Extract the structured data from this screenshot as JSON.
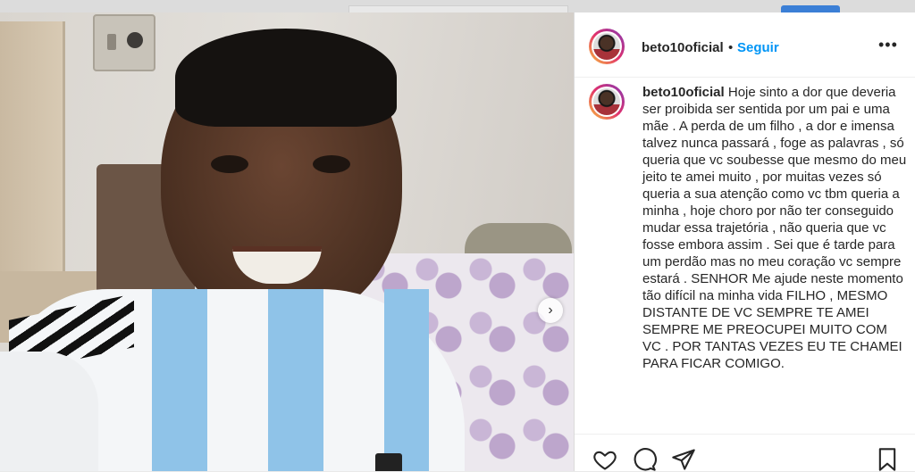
{
  "post": {
    "username": "beto10oficial",
    "separator": "•",
    "follow_label": "Seguir",
    "more_label": "•••",
    "caption": "Hoje sinto a dor que deveria ser proibida ser sentida por um pai e uma mãe . A perda de um filho , a dor e imensa talvez nunca passará , foge as palavras , só queria que vc soubesse que mesmo do meu jeito te amei muito , por muitas vezes só queria a sua atenção como vc tbm queria a minha , hoje choro por não ter conseguido mudar essa trajetória , não queria que vc fosse embora assim . Sei que é tarde para um perdão mas no meu coração vc sempre estará . SENHOR Me ajude neste momento tão difícil na minha vida FILHO , MESMO DISTANTE DE VC SEMPRE TE AMEI SEMPRE ME PREOCUPEI MUITO COM VC . POR TANTAS VEZES EU TE CHAMEI PARA FICAR COMIGO.",
    "carousel_next": "›"
  },
  "icons": {
    "like": "heart-icon",
    "comment": "comment-icon",
    "share": "paper-plane-icon",
    "save": "bookmark-icon"
  },
  "colors": {
    "accent": "#0095f6",
    "text": "#262626"
  }
}
